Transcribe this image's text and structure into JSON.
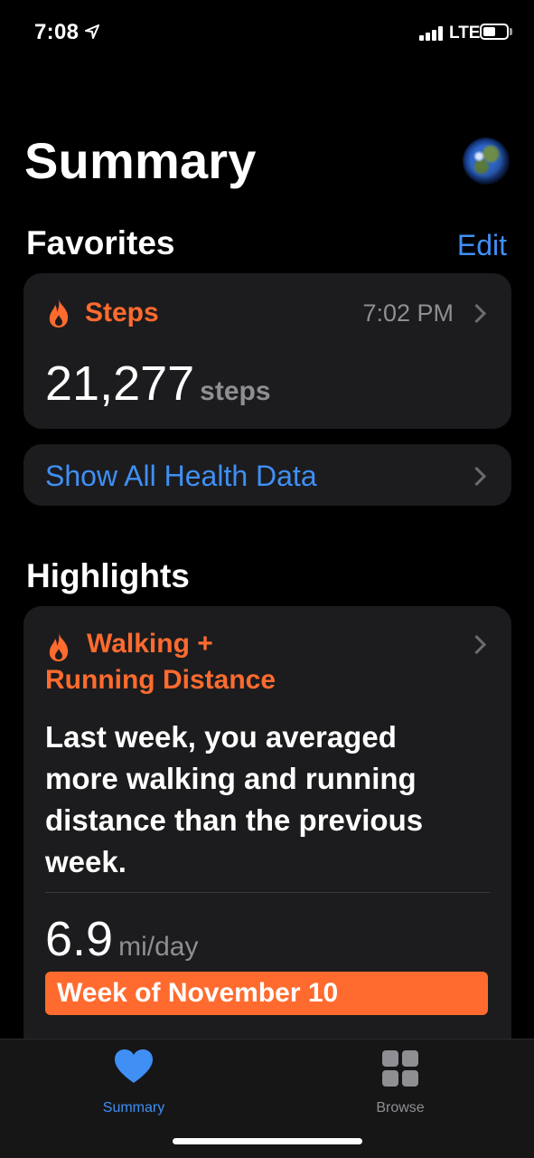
{
  "status_bar": {
    "time": "7:08",
    "network": "LTE",
    "battery_level": 0.55
  },
  "header": {
    "title": "Summary",
    "avatar_icon": "earth-avatar-icon"
  },
  "favorites": {
    "title": "Favorites",
    "edit_label": "Edit",
    "steps_card": {
      "label": "Steps",
      "time": "7:02 PM",
      "value": "21,277",
      "unit": "steps"
    },
    "show_all_label": "Show All Health Data"
  },
  "highlights": {
    "title": "Highlights",
    "card": {
      "title_line1": "Walking +",
      "title_line2": "Running Distance",
      "text": "Last week, you averaged more walking and running distance than the previous week.",
      "value": "6.9",
      "unit": "mi/day",
      "week_label": "Week of November 10"
    }
  },
  "tab_bar": {
    "tabs": [
      {
        "label": "Summary",
        "icon": "heart-icon",
        "active": true
      },
      {
        "label": "Browse",
        "icon": "grid-icon",
        "active": false
      }
    ]
  },
  "colors": {
    "accent_blue": "#3f8ff5",
    "activity_orange": "#ff6b2f",
    "card_bg": "#1c1c1e",
    "secondary_text": "#8e8e93"
  }
}
